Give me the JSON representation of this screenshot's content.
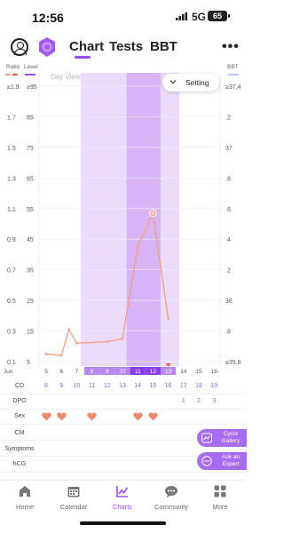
{
  "status_bar": {
    "time": "12:56",
    "network": "5G",
    "battery": "65"
  },
  "header": {
    "tabs": [
      {
        "label": "Chart",
        "active": true
      },
      {
        "label": "Tests",
        "active": false
      },
      {
        "label": "BBT",
        "active": false
      }
    ],
    "more": "•••"
  },
  "legend": {
    "ratio": "Ratio",
    "level": "Level",
    "bbt": "BBT"
  },
  "colors": {
    "accent": "#9a4df0",
    "line": "#f4a08a",
    "highlight_band": "#eadbfb",
    "highlight_dark": "#d7b5f7",
    "heart": "#ef8a6e"
  },
  "chart_data": {
    "type": "line",
    "view_label": "Day View",
    "y_ratio_ticks": [
      "≥1.9",
      "1.7",
      "1.5",
      "1.3",
      "1.1",
      "0.9",
      "0.7",
      "0.5",
      "0.3",
      "0.1"
    ],
    "y_level_ticks": [
      "≥95",
      "85",
      "75",
      "65",
      "55",
      "45",
      "35",
      "25",
      "15",
      "5"
    ],
    "y_bbt_ticks": [
      "≥37.4",
      ".2",
      "37",
      ".8",
      ".6",
      ".4",
      ".2",
      "36",
      ".8",
      "≤35.6"
    ],
    "x_month": "Jun",
    "x_dates": [
      "5",
      "6",
      "7",
      "8",
      "9",
      "10",
      "11",
      "12",
      "13",
      "14",
      "15",
      "16"
    ],
    "series": [
      {
        "points": [
          {
            "date": "5",
            "ratio": 0.15
          },
          {
            "date": "6",
            "ratio": 0.14
          },
          {
            "date": "6.5",
            "ratio": 0.31
          },
          {
            "date": "7",
            "ratio": 0.22
          },
          {
            "date": "9",
            "ratio": 0.23
          },
          {
            "date": "10",
            "ratio": 0.25
          },
          {
            "date": "11",
            "ratio": 0.85
          },
          {
            "date": "12",
            "ratio": 1.07
          },
          {
            "date": "13",
            "ratio": 0.38
          }
        ]
      }
    ],
    "ylim_ratio": [
      0.1,
      1.9
    ]
  },
  "setting": {
    "label": "Setting"
  },
  "rows": {
    "cd": {
      "label": "CD",
      "values": [
        "8",
        "9",
        "10",
        "11",
        "12",
        "13",
        "14",
        "15",
        "16",
        "17",
        "18",
        "19"
      ]
    },
    "dpo": {
      "label": "DPO",
      "values": [
        "",
        "",
        "",
        "",
        "",
        "",
        "",
        "",
        "",
        "1",
        "2",
        "3"
      ]
    },
    "sex": {
      "label": "Sex",
      "hearts": [
        true,
        true,
        false,
        true,
        false,
        false,
        true,
        true,
        false,
        false,
        false,
        false
      ]
    },
    "cm": {
      "label": "CM"
    },
    "symptoms": {
      "label": "Symptoms"
    },
    "hcg": {
      "label": "hCG"
    }
  },
  "fabs": {
    "cycle_gallery": "Cycle Gallery",
    "ask_expert": "Ask an Expert"
  },
  "nav": [
    {
      "label": "Home",
      "icon": "home-icon",
      "active": false
    },
    {
      "label": "Calendar",
      "icon": "calendar-icon",
      "active": false
    },
    {
      "label": "Charts",
      "icon": "charts-icon",
      "active": true
    },
    {
      "label": "Community",
      "icon": "community-icon",
      "active": false
    },
    {
      "label": "More",
      "icon": "more-grid-icon",
      "active": false
    }
  ]
}
